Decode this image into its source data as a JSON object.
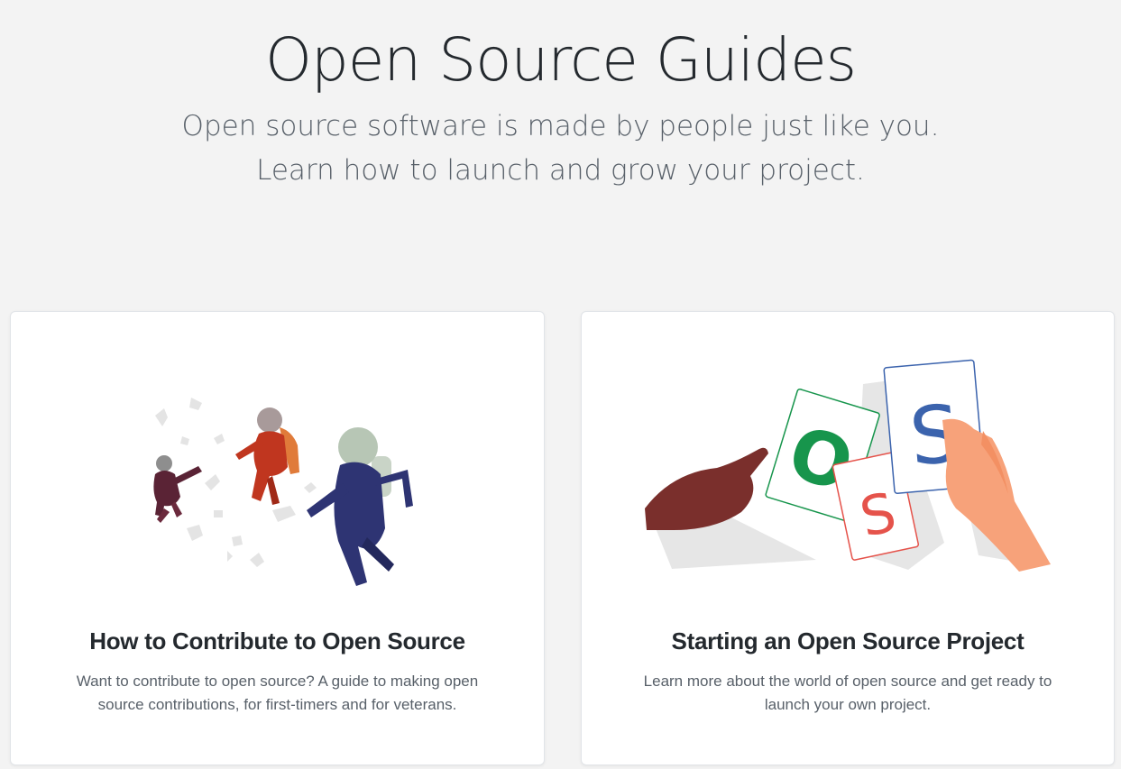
{
  "hero": {
    "title": "Open Source Guides",
    "lead_line1": "Open source software is made by people just like you.",
    "lead_line2": "Learn how to launch and grow your project."
  },
  "guides": [
    {
      "title": "How to Contribute to Open Source",
      "description": "Want to contribute to open source? A guide to making open source contributions, for first-timers and for veterans.",
      "illustration": "astronauts-illustration"
    },
    {
      "title": "Starting an Open Source Project",
      "description": "Learn more about the world of open source and get ready to launch your own project.",
      "illustration": "oss-cards-illustration",
      "card_letters": [
        "O",
        "S",
        "S"
      ]
    }
  ],
  "colors": {
    "background": "#f3f3f3",
    "card": "#ffffff",
    "heading": "#24292e",
    "muted": "#586069",
    "letter_o": "#17954c",
    "letter_s_red": "#e5534b",
    "letter_s_blue": "#3b63ad"
  }
}
